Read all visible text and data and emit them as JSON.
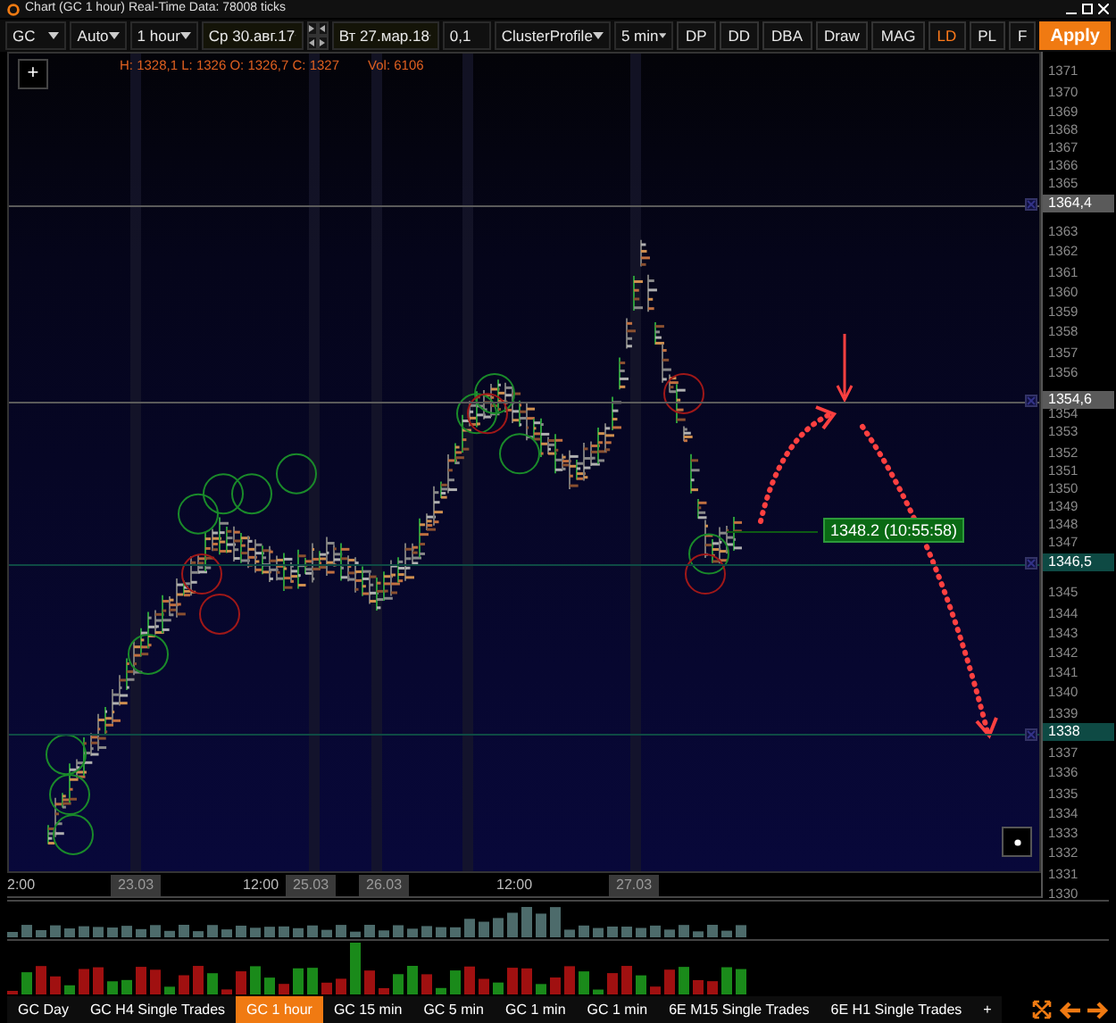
{
  "window": {
    "title": "Chart (GC 1 hour) Real-Time Data: 78008 ticks"
  },
  "toolbar": {
    "symbol": "GC",
    "scale": "Auto",
    "timeframe": "1 hour",
    "start_date": "Ср 30.авг.17",
    "end_date": "Вт 27.мар.18",
    "step": "0,1",
    "template": "ClusterProfile",
    "profile_period": "5 min",
    "buttons": [
      {
        "label": "DP",
        "selected": false
      },
      {
        "label": "DD",
        "selected": false
      },
      {
        "label": "DBA",
        "selected": false
      },
      {
        "label": "Draw",
        "selected": false
      },
      {
        "label": "MAG",
        "selected": false
      },
      {
        "label": "LD",
        "selected": true
      },
      {
        "label": "PL",
        "selected": false
      },
      {
        "label": "F",
        "selected": false
      }
    ],
    "apply": "Apply"
  },
  "chart": {
    "add_button": "+",
    "ohlc": "H: 1328,1 L: 1326 O: 1326,7 C: 1327",
    "volume": "Vol: 6106",
    "current_price": "1348.2 (10:55:58)",
    "price_ticks": [
      "1371",
      "1370",
      "1369",
      "1368",
      "1367",
      "1366",
      "1365",
      "1363",
      "1362",
      "1361",
      "1360",
      "1359",
      "1358",
      "1357",
      "1356",
      "1354",
      "1353",
      "1352",
      "1351",
      "1350",
      "1349",
      "1348",
      "1347",
      "1345",
      "1344",
      "1343",
      "1342",
      "1341",
      "1340",
      "1339",
      "1337",
      "1336",
      "1335",
      "1334",
      "1333",
      "1332",
      "1331",
      "1330"
    ],
    "levels": [
      {
        "label": "1364,4",
        "color": "#5a5a5a"
      },
      {
        "label": "1354,6",
        "color": "#5a5a5a"
      },
      {
        "label": "1346,5",
        "color": "#0e4a44"
      },
      {
        "label": "1338",
        "color": "#0e4a44"
      }
    ],
    "time_labels": [
      {
        "text": "2:00",
        "kind": "time"
      },
      {
        "text": "23.03",
        "kind": "date"
      },
      {
        "text": "12:00",
        "kind": "time"
      },
      {
        "text": "25.03",
        "kind": "date"
      },
      {
        "text": "26.03",
        "kind": "date"
      },
      {
        "text": "12:00",
        "kind": "time"
      },
      {
        "text": "27.03",
        "kind": "date"
      }
    ]
  },
  "tabs": [
    {
      "label": "GC Day",
      "selected": false
    },
    {
      "label": "GC H4 Single Trades",
      "selected": false
    },
    {
      "label": "GC 1 hour",
      "selected": true
    },
    {
      "label": "GC 15 min",
      "selected": false
    },
    {
      "label": "GC 5 min",
      "selected": false
    },
    {
      "label": "GC 1 min",
      "selected": false
    },
    {
      "label": "GC 1 min",
      "selected": false
    },
    {
      "label": "6E M15 Single Trades",
      "selected": false
    },
    {
      "label": "6E H1 Single Trades",
      "selected": false
    }
  ],
  "add_tab": "+"
}
